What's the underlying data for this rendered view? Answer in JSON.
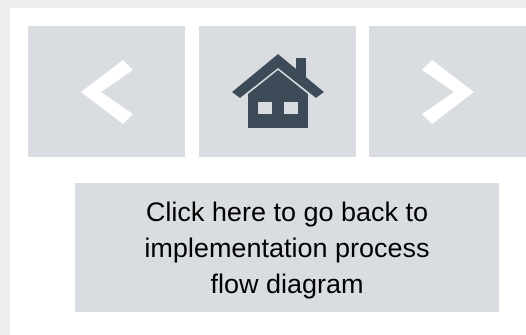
{
  "nav": {
    "prev": {
      "icon": "chevron-left-icon",
      "icon_color": "#ffffff"
    },
    "home": {
      "icon": "home-icon",
      "icon_color": "#3d4a57"
    },
    "next": {
      "icon": "chevron-right-icon",
      "icon_color": "#ffffff"
    },
    "button_bg": "#d9dde1"
  },
  "link": {
    "text": "Click here to go back to\nimplementation process\nflow diagram"
  }
}
